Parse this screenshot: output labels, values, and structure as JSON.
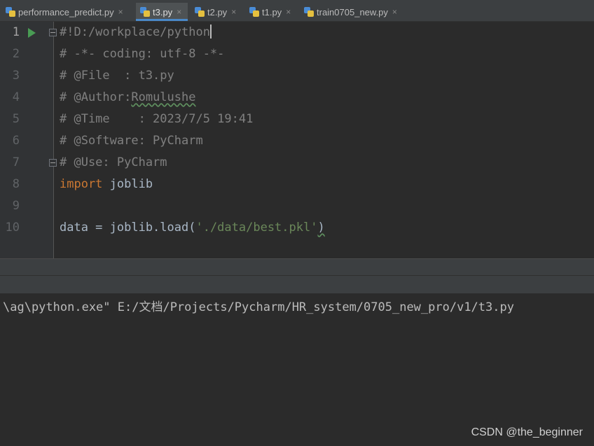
{
  "tabs": [
    {
      "label": "performance_predict.py",
      "active": false
    },
    {
      "label": "t3.py",
      "active": true
    },
    {
      "label": "t2.py",
      "active": false
    },
    {
      "label": "t1.py",
      "active": false
    },
    {
      "label": "train0705_new.py",
      "active": false
    }
  ],
  "close_glyph": "×",
  "lines": [
    {
      "num": "1",
      "text": "#!D:/workplace/python"
    },
    {
      "num": "2",
      "text": "# -*- coding: utf-8 -*-"
    },
    {
      "num": "3",
      "text": "# @File  : t3.py"
    },
    {
      "num": "4",
      "prefix": "# @Author:",
      "author": "Romulushe"
    },
    {
      "num": "5",
      "text": "# @Time    : 2023/7/5 19:41"
    },
    {
      "num": "6",
      "text": "# @Software: PyCharm"
    },
    {
      "num": "7",
      "text": "# @Use: PyCharm"
    },
    {
      "num": "8",
      "keyword": "import",
      "module": " joblib"
    },
    {
      "num": "9",
      "text": ""
    },
    {
      "num": "10",
      "pre": "data = joblib.load(",
      "str": "'./data/best.pkl'",
      "post": ")"
    }
  ],
  "console": {
    "line": "\\ag\\python.exe\" E:/文档/Projects/Pycharm/HR_system/0705_new_pro/v1/t3.py"
  },
  "watermark": "CSDN @the_beginner",
  "colors": {
    "background": "#2b2b2b",
    "comment": "#808080",
    "keyword": "#cc7832",
    "string": "#6a8759",
    "run_icon": "#499c54",
    "tab_underline": "#4a88c7"
  }
}
